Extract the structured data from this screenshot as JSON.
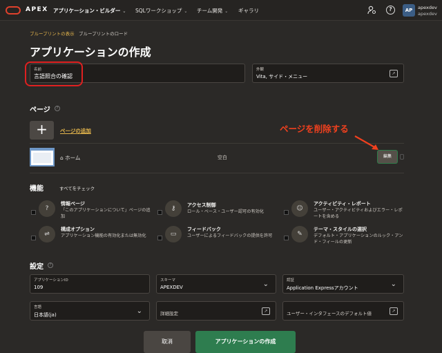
{
  "topbar": {
    "brand": "APEX",
    "nav": [
      {
        "label": "アプリケーション・ビルダー",
        "active": true
      },
      {
        "label": "SQLワークショップ"
      },
      {
        "label": "チーム開発"
      },
      {
        "label": "ギャラリ"
      }
    ],
    "avatar": "AP",
    "user_line1": "apexdev",
    "user_line2": "apexdev",
    "help": "?"
  },
  "breadcrumb": {
    "current": "ブループリントの表示",
    "parent": "ブループリントのロード"
  },
  "title": "アプリケーションの作成",
  "name_field": {
    "label": "名前",
    "value": "言語照合の確認"
  },
  "appearance_field": {
    "label": "外観",
    "value": "Vita, サイド・メニュー"
  },
  "pages": {
    "heading": "ページ",
    "add_link": "ページの追加",
    "items": [
      {
        "name": "ホーム",
        "type": "空白",
        "edit": "編集"
      }
    ]
  },
  "annotation": "ページを削除する",
  "features": {
    "heading": "機能",
    "check_all": "すべてをチェック",
    "items": [
      {
        "title": "情報ページ",
        "desc": "「このアプリケーションについて」ページの追加",
        "icon": "info-icon"
      },
      {
        "title": "アクセス制御",
        "desc": "ロール・ベース・ユーザー認可の有効化",
        "icon": "key-icon"
      },
      {
        "title": "アクティビティ・レポート",
        "desc": "ユーザー・アクティビティおよびエラー・レポートを含める",
        "icon": "user-activity-icon"
      },
      {
        "title": "構成オプション",
        "desc": "アプリケーション機能の有効化または無効化",
        "icon": "sliders-icon"
      },
      {
        "title": "フィードバック",
        "desc": "ユーザーによるフィードバックの提供を許可",
        "icon": "comment-icon"
      },
      {
        "title": "テーマ・スタイルの選択",
        "desc": "デフォルト・アプリケーションのルック・アンド・フィールの更新",
        "icon": "brush-icon"
      }
    ]
  },
  "settings": {
    "heading": "設定",
    "app_id": {
      "label": "アプリケーションID",
      "value": "109"
    },
    "schema": {
      "label": "スキーマ",
      "value": "APEXDEV"
    },
    "auth": {
      "label": "認証",
      "value": "Application Expressアカウント"
    },
    "language": {
      "label": "言語",
      "value": "日本語(ja)"
    },
    "advanced": {
      "label": "詳細設定"
    },
    "ui_default": {
      "label": "ユーザー・インタフェースのデフォルト値"
    }
  },
  "buttons": {
    "cancel": "取消",
    "create": "アプリケーションの作成"
  },
  "colors": {
    "accent_green": "#2e7d4f",
    "link_gold": "#e8b84d",
    "annotation_red": "#f0401e",
    "bg": "#2b2927"
  }
}
